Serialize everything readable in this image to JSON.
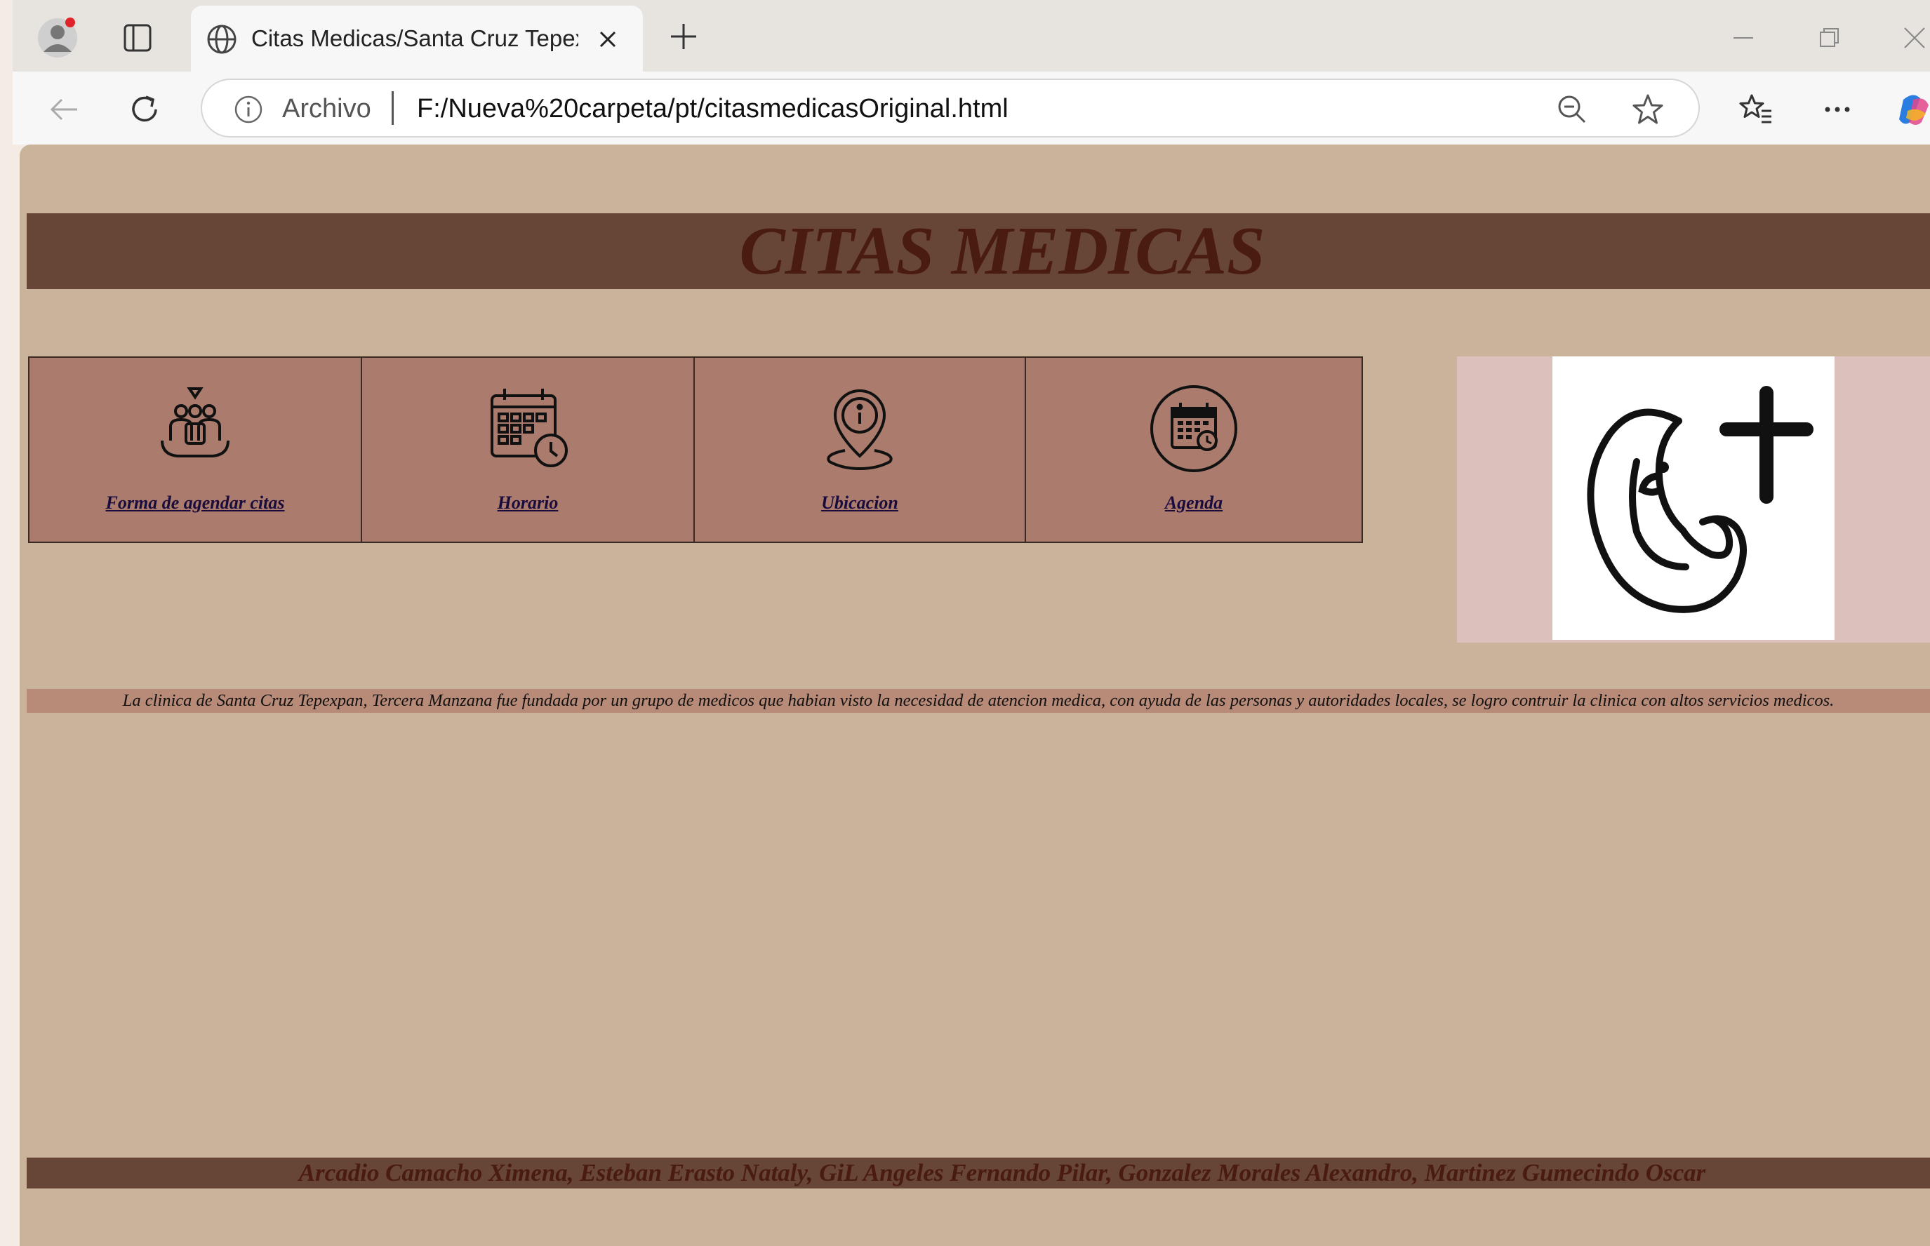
{
  "browser": {
    "tab_title": "Citas Medicas/Santa Cruz Tepexpan",
    "address_scheme": "Archivo",
    "address_url": "F:/Nueva%20carpeta/pt/citasmedicasOriginal.html",
    "icons": [
      "profile-icon",
      "tab-actions-icon",
      "globe-icon",
      "close-icon",
      "plus-icon",
      "minimize-icon",
      "restore-icon",
      "back-icon",
      "reload-icon",
      "info-icon",
      "zoom-out-icon",
      "star-icon",
      "favorites-icon",
      "more-icon",
      "copilot-icon"
    ]
  },
  "page": {
    "header_title": "CITAS MEDICAS",
    "menu": [
      {
        "label": "Forma de agendar citas",
        "icon": "group-people-icon"
      },
      {
        "label": "Horario",
        "icon": "calendar-clock-icon"
      },
      {
        "label": "Ubicacion",
        "icon": "location-pin-icon"
      },
      {
        "label": "Agenda",
        "icon": "agenda-calendar-icon"
      }
    ],
    "logo": "mother-child-cross-logo",
    "description": "La clinica de Santa Cruz Tepexpan, Tercera Manzana fue fundada por un grupo de medicos que habian visto la necesidad de atencion medica, con ayuda de las personas y autoridades locales, se logro contruir la clinica con altos servicios medicos.",
    "footer_authors": "Arcadio Camacho Ximena, Esteban Erasto Nataly, GiL Angeles Fernando Pilar, Gonzalez Morales Alexandro, Martinez Gumecindo Oscar"
  },
  "colors": {
    "page_background": "#c9b39a",
    "header_band": "#674537",
    "title_text": "#4a1b10",
    "menu_background": "#ab7c6e",
    "description_band": "#b88a78",
    "logo_background": "#dcc0bc"
  }
}
